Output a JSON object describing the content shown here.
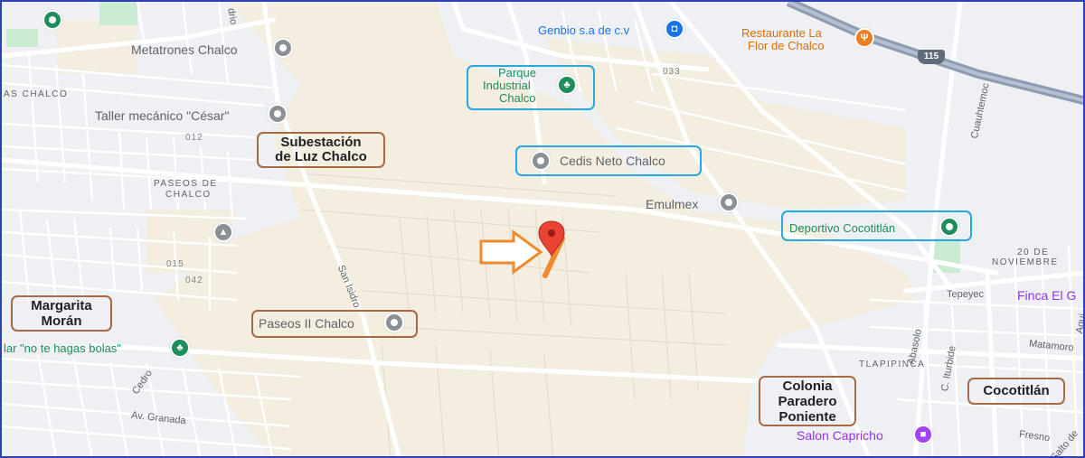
{
  "map": {
    "pois": {
      "metatrones": "Metatrones Chalco",
      "taller": "Taller mecánico \"César\"",
      "genbio": "Genbio s.a de c.v",
      "restaurante_line1": "Restaurante La",
      "restaurante_line2": "Flor de Chalco",
      "parque_line1": "Parque",
      "parque_line2": "Industrial",
      "parque_line3": "Chalco",
      "cedis": "Cedis Neto Chalco",
      "emulmex": "Emulmex",
      "deportivo": "Deportivo Cocotitlán",
      "paseos2": "Paseos II Chalco",
      "nohagas": "lar \"no te hagas bolas\"",
      "finca": "Finca El G",
      "salon": "Salon Capricho"
    },
    "areas": {
      "as_chalco": "AS CHALCO",
      "paseos_line1": "PASEOS DE",
      "paseos_line2": "CHALCO",
      "veinte_line1": "20 DE",
      "veinte_line2": "NOVIEMBRE",
      "tlapipinca": "TLAPIPINCA"
    },
    "roads": {
      "drio": "drio",
      "san_isidro": "San Isidro",
      "cuauhtemoc": "Cuauhtemoc",
      "tepeyec": "Tepeyec",
      "abasolo": "Abasolo",
      "iturbide": "C. Iturbide",
      "matamoros": "Matamoro",
      "cedro": "Cedro",
      "granada": "Av. Granada",
      "fresno": "Fresno",
      "salto": "Salto de",
      "agui": "Agui"
    },
    "numbers": {
      "n012": "012",
      "n015": "015",
      "n042": "042",
      "n033": "033"
    },
    "highway_shield": "115",
    "annotations": {
      "subestacion_line1": "Subestación",
      "subestacion_line2": "de Luz Chalco",
      "margarita_line1": "Margarita",
      "margarita_line2": "Morán",
      "colonia_line1": "Colonia",
      "colonia_line2": "Paradero",
      "colonia_line3": "Poniente",
      "cocotitlan": "Cocotitlán"
    },
    "colors": {
      "land": "#eef0f3",
      "farmland": "#f3eee0",
      "road_minor": "#ffffff",
      "highway": "#8e9bb0",
      "brown_box": "#a86a45",
      "blue_box": "#29a8df",
      "arrow": "#f08a2c",
      "marker": "#ea4335"
    },
    "icons": {
      "gray_pin": "location-dot-icon",
      "green_pin": "tree-icon",
      "blue_pin": "shopping-bag-icon",
      "orange_pin": "restaurant-icon",
      "purple_pin": "gift-icon",
      "school": "graduation-cap-icon",
      "marker": "red-map-marker-icon",
      "arrow": "orange-arrow-icon"
    }
  }
}
